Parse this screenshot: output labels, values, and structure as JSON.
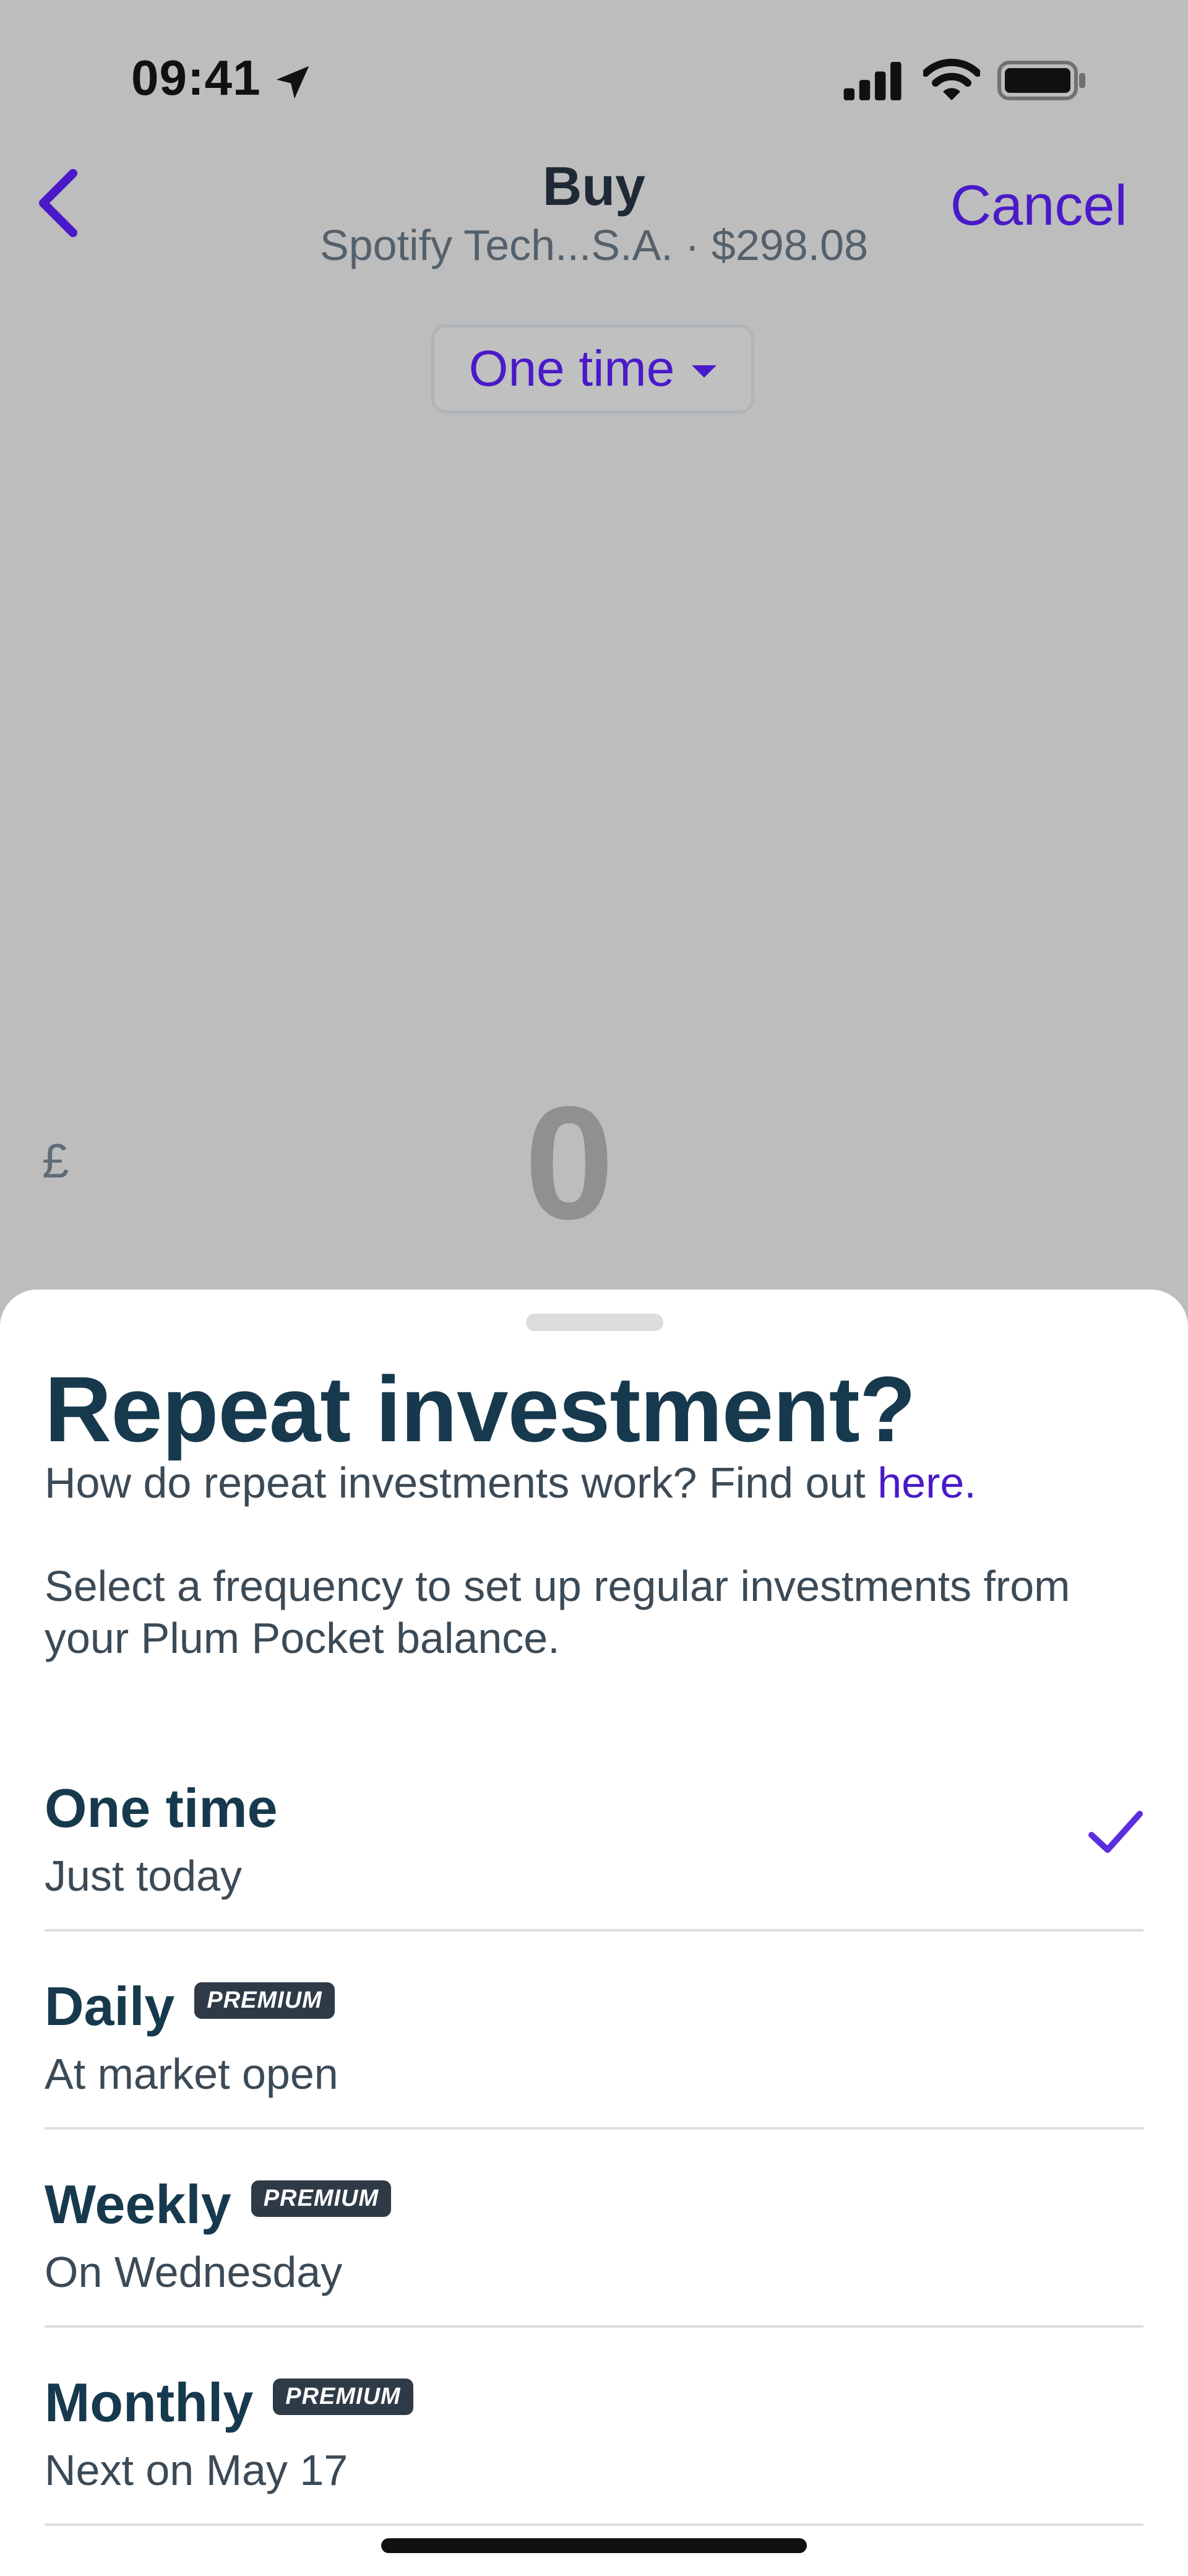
{
  "status_bar": {
    "time": "09:41",
    "location_icon": "location-arrow-icon",
    "signal_icon": "cellular-signal-icon",
    "wifi_icon": "wifi-icon",
    "battery_icon": "battery-icon"
  },
  "header": {
    "back_icon": "chevron-left-icon",
    "title": "Buy",
    "subtitle": "Spotify Tech...S.A. · $298.08",
    "cancel_label": "Cancel"
  },
  "frequency_pill": {
    "label": "One time",
    "caret_icon": "caret-down-icon"
  },
  "amount": {
    "currency": "£",
    "value": "0"
  },
  "sheet": {
    "title": "Repeat investment?",
    "help_text": "How do repeat investments work? Find out ",
    "help_link": "here.",
    "description": "Select a frequency to set up regular investments from your Plum Pocket balance.",
    "options": [
      {
        "title": "One time",
        "subtitle": "Just today",
        "badge": "",
        "selected": true
      },
      {
        "title": "Daily",
        "subtitle": "At market open",
        "badge": "PREMIUM",
        "selected": false
      },
      {
        "title": "Weekly",
        "subtitle": "On Wednesday",
        "badge": "PREMIUM",
        "selected": false
      },
      {
        "title": "Monthly",
        "subtitle": "Next on May 17",
        "badge": "PREMIUM",
        "selected": false
      }
    ]
  },
  "colors": {
    "accent": "#4a19c9",
    "heading": "#17394d",
    "overlay_background": "#bdbdbd",
    "badge_background": "#2e3b47"
  }
}
